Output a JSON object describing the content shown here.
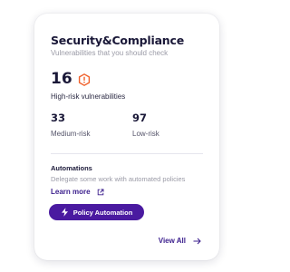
{
  "card": {
    "title": "Security&Compliance",
    "subtitle": "Vulnerabilities that you should check"
  },
  "high_risk": {
    "count": "16",
    "label": "High-risk vulnerabilities",
    "icon": "alert-hexagon-icon",
    "icon_color": "#f0602a"
  },
  "medium_risk": {
    "count": "33",
    "label": "Medium-risk"
  },
  "low_risk": {
    "count": "97",
    "label": "Low-risk"
  },
  "automations": {
    "title": "Automations",
    "description": "Delegate some work with automated policies",
    "learn_more_label": "Learn more",
    "learn_more_icon": "external-link-icon",
    "button_label": "Policy Automation",
    "button_icon": "bolt-icon",
    "button_color": "#4a1aa0"
  },
  "footer": {
    "view_all_label": "View All",
    "view_all_icon": "arrow-right-icon"
  }
}
